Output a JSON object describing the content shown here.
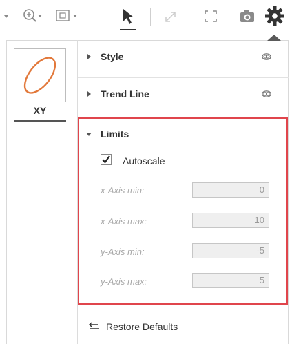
{
  "toolbar": {
    "items": [
      "zoom-dropdown",
      "pan-dropdown",
      "pointer",
      "expand",
      "fullscreen",
      "camera",
      "settings"
    ],
    "active": "settings"
  },
  "plot": {
    "label": "XY"
  },
  "sections": {
    "style": {
      "title": "Style"
    },
    "trend_line": {
      "title": "Trend Line"
    },
    "limits": {
      "title": "Limits",
      "autoscale_label": "Autoscale",
      "autoscale_checked": true,
      "fields": [
        {
          "label": "x-Axis min:",
          "value": "0"
        },
        {
          "label": "x-Axis max:",
          "value": "10"
        },
        {
          "label": "y-Axis min:",
          "value": "-5"
        },
        {
          "label": "y-Axis max:",
          "value": "5"
        }
      ]
    }
  },
  "restore_defaults": "Restore Defaults",
  "colors": {
    "highlight_border": "#e0454c",
    "ellipse_stroke": "#e2783a"
  }
}
